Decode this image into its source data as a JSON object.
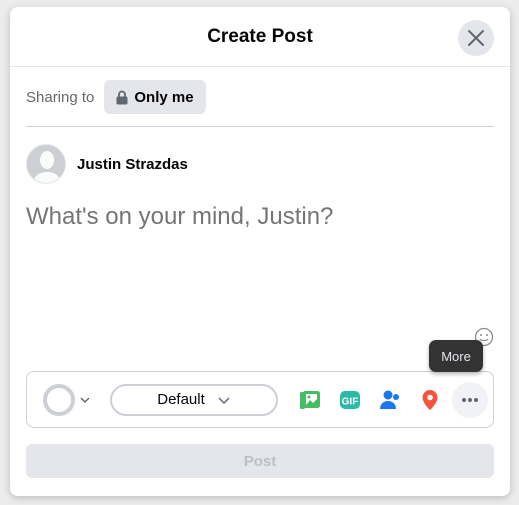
{
  "header": {
    "title": "Create Post"
  },
  "sharing": {
    "label": "Sharing to",
    "audience": "Only me"
  },
  "user": {
    "name": "Justin Strazdas"
  },
  "composer": {
    "placeholder": "What's on your mind, Justin?"
  },
  "toolbar": {
    "font_style": "Default",
    "tooltip": "More",
    "icons": [
      "photo-video-icon",
      "gif-icon",
      "tag-people-icon",
      "location-icon",
      "more-icon"
    ]
  },
  "footer": {
    "post_label": "Post"
  },
  "colors": {
    "photo": "#45bd62",
    "gif": "#2abba7",
    "tag": "#1877f2",
    "location": "#f5533d"
  }
}
